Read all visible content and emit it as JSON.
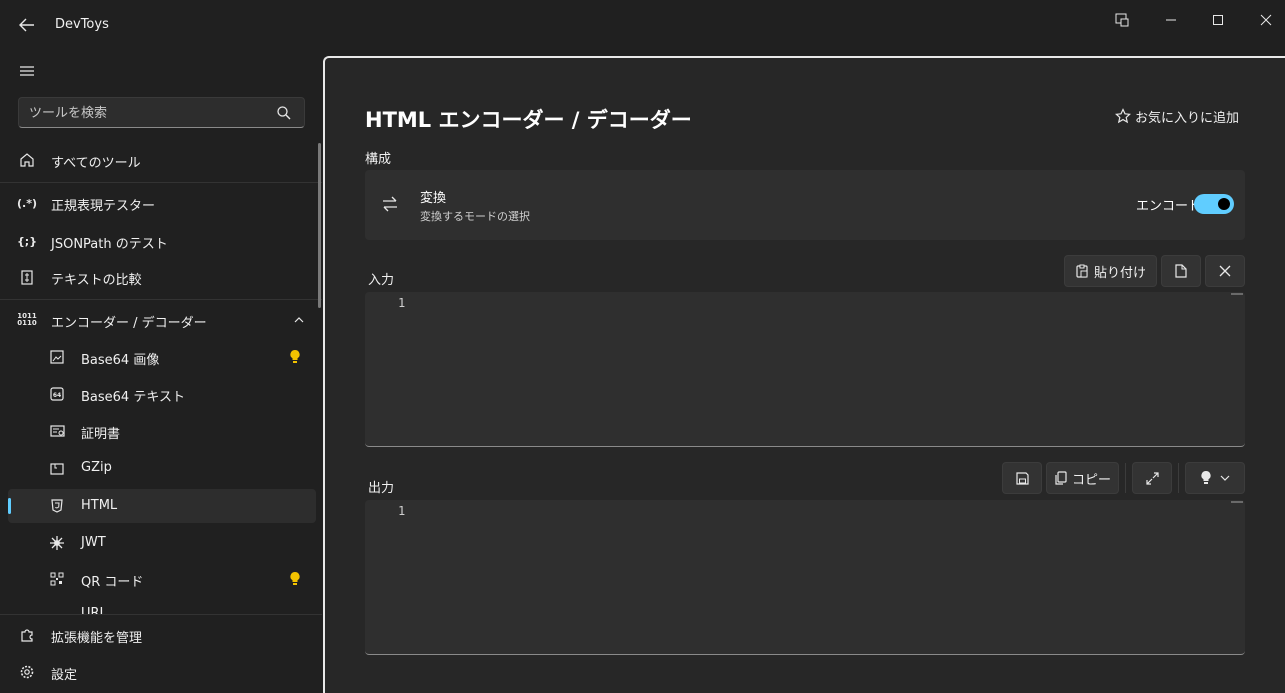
{
  "app": {
    "title": "DevToys"
  },
  "sidebar": {
    "search_placeholder": "ツールを検索",
    "items": [
      {
        "label": "すべてのツール"
      },
      {
        "label": "正規表現テスター",
        "icon_text": "(.*)"
      },
      {
        "label": "JSONPath のテスト",
        "icon_text": "{;}"
      },
      {
        "label": "テキストの比較"
      },
      {
        "label": "エンコーダー / デコーダー",
        "icon_text": "1011\n0110"
      },
      {
        "label": "Base64 画像"
      },
      {
        "label": "Base64 テキスト"
      },
      {
        "label": "証明書"
      },
      {
        "label": "GZip"
      },
      {
        "label": "HTML"
      },
      {
        "label": "JWT"
      },
      {
        "label": "QR コード"
      },
      {
        "label": "URL"
      }
    ],
    "footer": [
      {
        "label": "拡張機能を管理"
      },
      {
        "label": "設定"
      }
    ]
  },
  "main": {
    "title": "HTML エンコーダー / デコーダー",
    "favorite_label": "お気に入りに追加",
    "config_label": "構成",
    "conversion": {
      "title": "変換",
      "subtitle": "変換するモードの選択",
      "toggle_label": "エンコード",
      "toggle_on": true
    },
    "input": {
      "label": "入力",
      "paste_label": "貼り付け",
      "line_number": "1"
    },
    "output": {
      "label": "出力",
      "copy_label": "コピー",
      "line_number": "1"
    }
  },
  "colors": {
    "accent": "#60cdff",
    "bulb": "#f2c200"
  }
}
